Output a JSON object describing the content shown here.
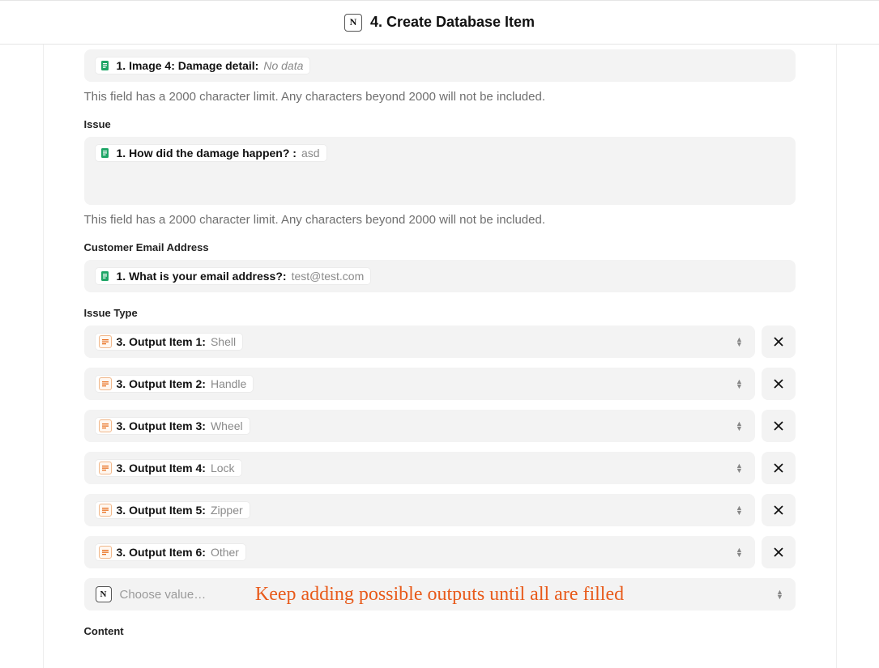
{
  "header": {
    "icon_letter": "N",
    "title": "4. Create Database Item"
  },
  "sections": {
    "image4": {
      "chip_label": "1. Image 4: Damage detail:",
      "chip_value": "No data"
    },
    "limit_text": "This field has a 2000 character limit. Any characters beyond 2000 will not be included.",
    "issue_label": "Issue",
    "issue_chip_label": "1. How did the damage happen? :",
    "issue_chip_value": "asd",
    "email_label": "Customer Email Address",
    "email_chip_label": "1. What is your email address?:",
    "email_chip_value": "test@test.com",
    "issue_type_label": "Issue Type",
    "issue_type_items": [
      {
        "label": "3. Output Item 1:",
        "value": "Shell"
      },
      {
        "label": "3. Output Item 2:",
        "value": "Handle"
      },
      {
        "label": "3. Output Item 3:",
        "value": "Wheel"
      },
      {
        "label": "3. Output Item 4:",
        "value": "Lock"
      },
      {
        "label": "3. Output Item 5:",
        "value": "Zipper"
      },
      {
        "label": "3. Output Item 6:",
        "value": "Other"
      }
    ],
    "choose_placeholder": "Choose value…",
    "annotation_text": "Keep adding possible outputs until all are filled",
    "content_label": "Content"
  }
}
